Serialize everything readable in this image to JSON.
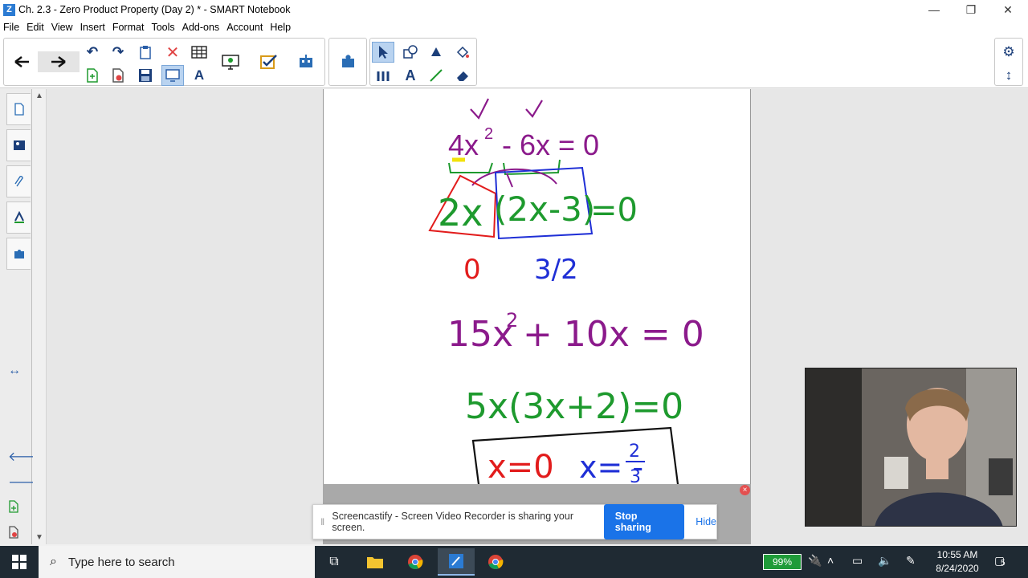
{
  "window": {
    "title": "Ch. 2.3 - Zero Product Property (Day 2) * - SMART Notebook",
    "app_icon": "smart-notebook-icon",
    "minimize": "—",
    "restore": "❐",
    "close": "✕"
  },
  "menu": [
    "File",
    "Edit",
    "View",
    "Insert",
    "Format",
    "Tools",
    "Add-ons",
    "Account",
    "Help"
  ],
  "toolbar": {
    "back": "🡐",
    "forward": "🡒",
    "undo": "↶",
    "redo": "↷",
    "delete": "✕",
    "table": "▦",
    "save": "💾",
    "settings": "⚙",
    "expand": "↕"
  },
  "page": {
    "eq1": "4x",
    "eq1_exp": "2",
    "eq1_rest": "- 6x = 0",
    "factor_a": "2x",
    "factor_b": "(2x-3)",
    "eq_zero": "=0",
    "sol1": "0",
    "sol2": "3/2",
    "eq2": "15x",
    "eq2_exp": "2",
    "eq2_rest": "+ 10x = 0",
    "eq3": "5x(3x+2)=0",
    "ans1": "x=0",
    "ans2_prefix": "x= -",
    "ans2_num": "2",
    "ans2_den": "3",
    "colors": {
      "purple": "#8b1a8b",
      "green": "#1e9a2e",
      "red": "#e21c1c",
      "blue": "#1f2fd6"
    }
  },
  "share": {
    "message": "Screencastify - Screen Video Recorder is sharing your screen.",
    "stop_label": "Stop sharing",
    "hide_label": "Hide"
  },
  "taskbar": {
    "search_placeholder": "Type here to search",
    "battery": "99%",
    "time": "10:55 AM",
    "date": "8/24/2020",
    "notifications": "5"
  }
}
